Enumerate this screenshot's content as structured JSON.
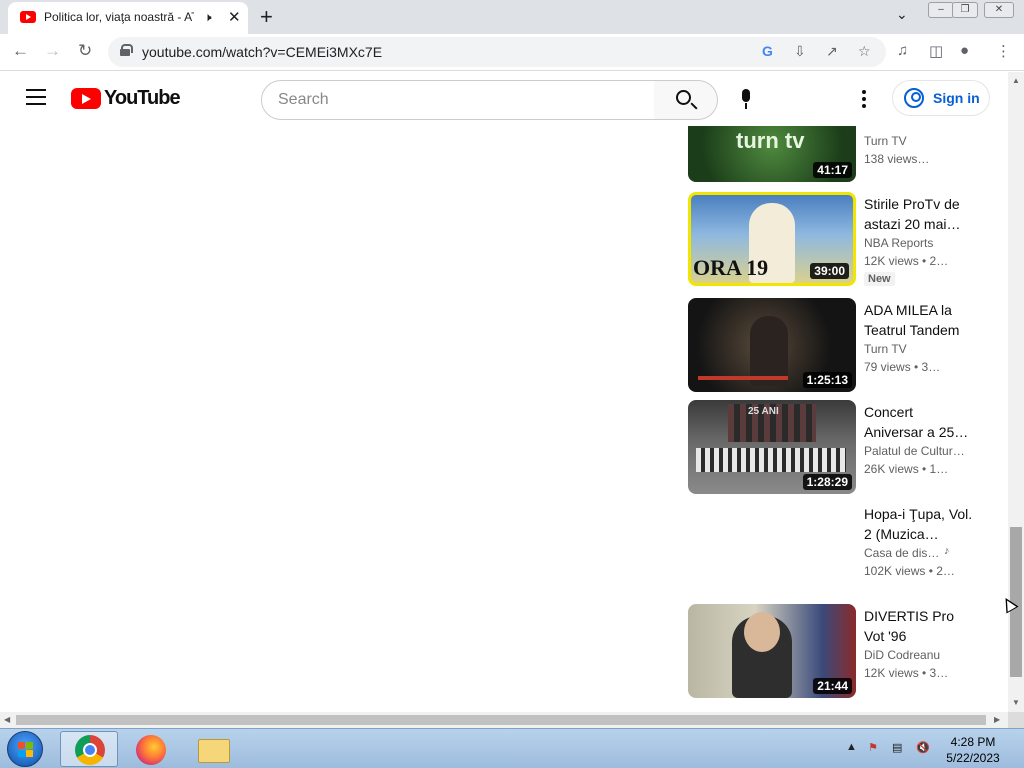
{
  "browser": {
    "tab_title": "Politica lor, viaţa noastră - AT",
    "url": "youtube.com/watch?v=CEMEi3MXc7E"
  },
  "youtube": {
    "logo_text": "YouTube",
    "search_placeholder": "Search",
    "signin_label": "Sign in"
  },
  "videos": [
    {
      "title": "",
      "channel": "Turn TV",
      "meta": "138 views…",
      "duration": "41:17",
      "thumb_text": "turn tv"
    },
    {
      "title": "Stirile ProTv de astazi 20 mai…",
      "channel": "NBA Reports",
      "meta": "12K views  • 2…",
      "badge": "New",
      "duration": "39:00",
      "thumb_text": "ORA 19"
    },
    {
      "title": "ADA MILEA la Teatrul Tandem",
      "channel": "Turn TV",
      "meta": "79 views  • 3…",
      "duration": "1:25:13"
    },
    {
      "title": "Concert Aniversar a 25…",
      "channel": "Palatul de Cultur…",
      "meta": "26K views  • 1…",
      "duration": "1:28:29",
      "thumb_text": "25 ANI"
    },
    {
      "title": "Hopa-i Ţupa, Vol. 2 (Muzica…",
      "channel": "Casa de dis…",
      "meta": "102K views  • 2…"
    },
    {
      "title": "DIVERTIS Pro Vot '96",
      "channel": "DiD Codreanu",
      "meta": "12K views  • 3…",
      "duration": "21:44"
    }
  ],
  "taskbar": {
    "time": "4:28 PM",
    "date": "5/22/2023"
  },
  "colors": {
    "youtube_red": "#ff0000",
    "link_blue": "#065fd4",
    "taskbar": "#b8d2ec"
  }
}
